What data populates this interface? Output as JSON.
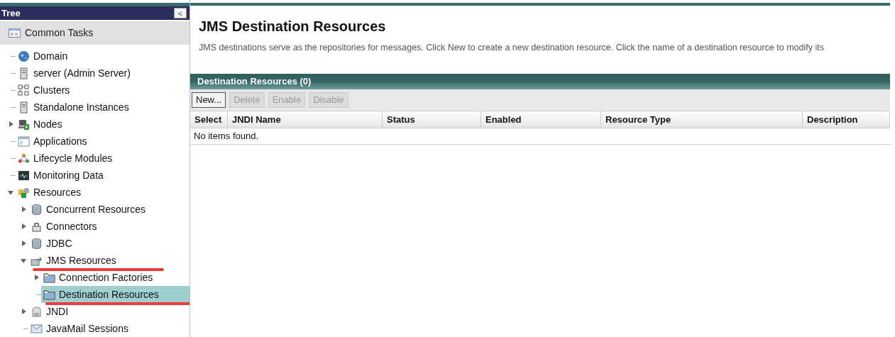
{
  "tree": {
    "title": "Tree",
    "collapse_button": "<",
    "common_tasks": "Common Tasks",
    "items": [
      {
        "label": "Domain",
        "selected": false,
        "annotated": false
      },
      {
        "label": "server (Admin Server)",
        "selected": false,
        "annotated": false
      },
      {
        "label": "Clusters",
        "selected": false,
        "annotated": false
      },
      {
        "label": "Standalone Instances",
        "selected": false,
        "annotated": false
      },
      {
        "label": "Nodes",
        "selected": false,
        "annotated": false,
        "expanded": false
      },
      {
        "label": "Applications",
        "selected": false,
        "annotated": false
      },
      {
        "label": "Lifecycle Modules",
        "selected": false,
        "annotated": false
      },
      {
        "label": "Monitoring Data",
        "selected": false,
        "annotated": false
      },
      {
        "label": "Resources",
        "selected": false,
        "annotated": false,
        "expanded": true,
        "children": [
          {
            "label": "Concurrent Resources",
            "selected": false,
            "annotated": false,
            "expanded": false
          },
          {
            "label": "Connectors",
            "selected": false,
            "annotated": false,
            "expanded": false
          },
          {
            "label": "JDBC",
            "selected": false,
            "annotated": false,
            "expanded": false
          },
          {
            "label": "JMS Resources",
            "selected": false,
            "annotated": true,
            "expanded": true,
            "children": [
              {
                "label": "Connection Factories",
                "selected": false,
                "annotated": false,
                "expanded": false
              },
              {
                "label": "Destination Resources",
                "selected": true,
                "annotated": true
              }
            ]
          },
          {
            "label": "JNDI",
            "selected": false,
            "annotated": false,
            "expanded": false
          },
          {
            "label": "JavaMail Sessions",
            "selected": false,
            "annotated": false
          }
        ]
      }
    ]
  },
  "main": {
    "title": "JMS Destination Resources",
    "description": "JMS destinations serve as the repositories for messages. Click New to create a new destination resource. Click the name of a destination resource to modify its",
    "table": {
      "title": "Destination Resources (0)",
      "buttons": [
        {
          "label": "New...",
          "disabled": false
        },
        {
          "label": "Delete",
          "disabled": true
        },
        {
          "label": "Enable",
          "disabled": true
        },
        {
          "label": "Disable",
          "disabled": true
        }
      ],
      "columns": [
        "Select",
        "JNDI Name",
        "Status",
        "Enabled",
        "Resource Type",
        "Description"
      ],
      "empty_message": "No items found."
    }
  }
}
